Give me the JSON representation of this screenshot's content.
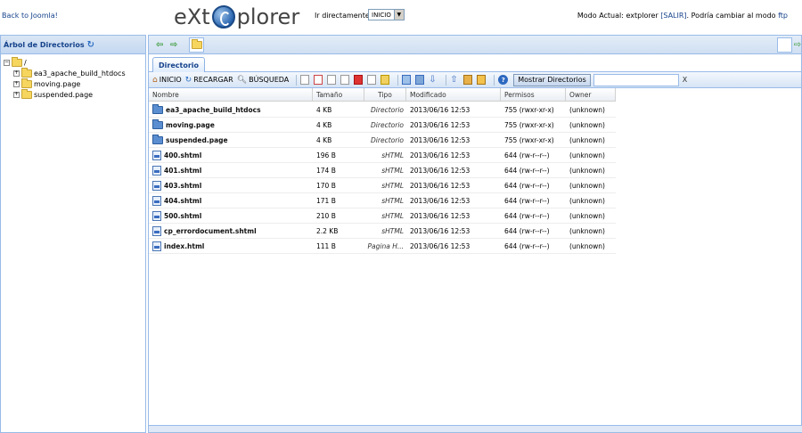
{
  "header": {
    "back_link": "Back to Joomla!",
    "logo_left": "eXt",
    "logo_right": "plorer",
    "jump_label": "Ir directamente a:",
    "jump_value": "INICIO",
    "mode_prefix": "Modo Actual: extplorer",
    "mode_logout": "[SALIR]",
    "mode_middle": ". Podría cambiar al modo",
    "mode_ftp": "ftp"
  },
  "tree": {
    "title": "Árbol de Directorios",
    "root_label": "/",
    "items": [
      {
        "label": "ea3_apache_build_htdocs"
      },
      {
        "label": "moving.page"
      },
      {
        "label": "suspended.page"
      }
    ]
  },
  "tabs": {
    "active": "Directorio"
  },
  "toolbar": {
    "home": "INICIO",
    "reload": "RECARGAR",
    "search": "BÚSQUEDA",
    "show_dirs": "Mostrar Directorios",
    "filter_placeholder": "",
    "clear": "X"
  },
  "grid": {
    "columns": [
      "Nombre",
      "Tamaño",
      "Tipo",
      "Modificado",
      "Permisos",
      "Owner"
    ],
    "rows": [
      {
        "kind": "dir",
        "name": "ea3_apache_build_htdocs",
        "size": "4 KB",
        "type": "Directorio",
        "modified": "2013/06/16 12:53",
        "perms": "755 (rwxr-xr-x)",
        "owner": "(unknown)"
      },
      {
        "kind": "dir",
        "name": "moving.page",
        "size": "4 KB",
        "type": "Directorio",
        "modified": "2013/06/16 12:53",
        "perms": "755 (rwxr-xr-x)",
        "owner": "(unknown)"
      },
      {
        "kind": "dir",
        "name": "suspended.page",
        "size": "4 KB",
        "type": "Directorio",
        "modified": "2013/06/16 12:53",
        "perms": "755 (rwxr-xr-x)",
        "owner": "(unknown)"
      },
      {
        "kind": "file",
        "name": "400.shtml",
        "size": "196 B",
        "type": "sHTML",
        "modified": "2013/06/16 12:53",
        "perms": "644 (rw-r--r--)",
        "owner": "(unknown)"
      },
      {
        "kind": "file",
        "name": "401.shtml",
        "size": "174 B",
        "type": "sHTML",
        "modified": "2013/06/16 12:53",
        "perms": "644 (rw-r--r--)",
        "owner": "(unknown)"
      },
      {
        "kind": "file",
        "name": "403.shtml",
        "size": "170 B",
        "type": "sHTML",
        "modified": "2013/06/16 12:53",
        "perms": "644 (rw-r--r--)",
        "owner": "(unknown)"
      },
      {
        "kind": "file",
        "name": "404.shtml",
        "size": "171 B",
        "type": "sHTML",
        "modified": "2013/06/16 12:53",
        "perms": "644 (rw-r--r--)",
        "owner": "(unknown)"
      },
      {
        "kind": "file",
        "name": "500.shtml",
        "size": "210 B",
        "type": "sHTML",
        "modified": "2013/06/16 12:53",
        "perms": "644 (rw-r--r--)",
        "owner": "(unknown)"
      },
      {
        "kind": "file",
        "name": "cp_errordocument.shtml",
        "size": "2.2 KB",
        "type": "sHTML",
        "modified": "2013/06/16 12:53",
        "perms": "644 (rw-r--r--)",
        "owner": "(unknown)"
      },
      {
        "kind": "file",
        "name": "index.html",
        "size": "111 B",
        "type": "Pagina H...",
        "modified": "2013/06/16 12:53",
        "perms": "644 (rw-r--r--)",
        "owner": "(unknown)"
      }
    ]
  },
  "colors": {
    "panel_border": "#99bbe8",
    "header_text": "#15428b",
    "dir_icon": "#5b8ed1",
    "tree_folder": "#f6d65e"
  }
}
